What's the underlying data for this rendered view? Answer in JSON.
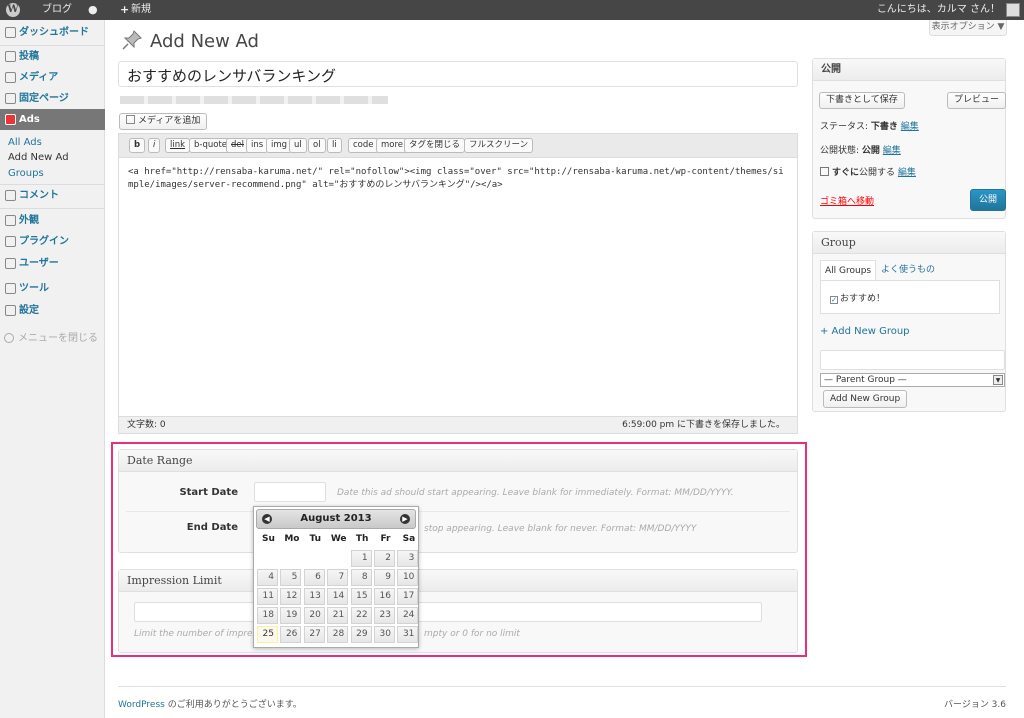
{
  "adminbar": {
    "blog": "ブログ",
    "new": "新規",
    "greeting": "こんにちは、カルマ さん！"
  },
  "sidebar": {
    "items": [
      {
        "label": "ダッシュボード"
      },
      {
        "label": "投稿"
      },
      {
        "label": "メディア"
      },
      {
        "label": "固定ページ"
      },
      {
        "label": "Ads"
      },
      {
        "label": "コメント"
      },
      {
        "label": "外観"
      },
      {
        "label": "プラグイン"
      },
      {
        "label": "ユーザー"
      },
      {
        "label": "ツール"
      },
      {
        "label": "設定"
      }
    ],
    "submenu": [
      "All Ads",
      "Add New Ad",
      "Groups"
    ],
    "collapse": "メニューを閉じる"
  },
  "header": {
    "screen_options": "表示オプション ▼",
    "title": "Add New Ad"
  },
  "post": {
    "title_value": "おすすめのレンサバランキング",
    "add_media": "メディアを追加"
  },
  "editor": {
    "quicktags": [
      "b",
      "i",
      "link",
      "b-quote",
      "del",
      "ins",
      "img",
      "ul",
      "ol",
      "li",
      "code",
      "more",
      "タグを閉じる",
      "フルスクリーン"
    ],
    "content": "<a href=\"http://rensaba-karuma.net/\" rel=\"nofollow\"><img class=\"over\" src=\"http://rensaba-karuma.net/wp-content/themes/simple/images/server-recommend.png\" alt=\"おすすめのレンサバランキング\"/></a>",
    "word_count": "文字数: 0",
    "draft_saved": "6:59:00 pm に下書きを保存しました。"
  },
  "date_range": {
    "heading": "Date Range",
    "start_label": "Start Date",
    "start_desc": "Date this ad should start appearing. Leave blank for immediately. Format: MM/DD/YYYY.",
    "end_label": "End Date",
    "end_desc": "stop appearing. Leave blank for never. Format: MM/DD/YYYY"
  },
  "calendar": {
    "month": "August 2013",
    "dow": [
      "Su",
      "Mo",
      "Tu",
      "We",
      "Th",
      "Fr",
      "Sa"
    ],
    "first_weekday": 4,
    "days": 31,
    "today": 25
  },
  "impression": {
    "heading": "Impression Limit",
    "desc_left": "Limit the number of impress",
    "desc_right": "mpty or 0 for no limit"
  },
  "publish": {
    "heading": "公開",
    "save_draft": "下書きとして保存",
    "preview": "プレビュー",
    "status_label": "ステータス: ",
    "status_value": "下書き",
    "visibility_label": "公開状態: ",
    "visibility_value": "公開",
    "schedule_label": "すぐに",
    "schedule_suffix": "公開する",
    "edit": "編集",
    "trash": "ゴミ箱へ移動",
    "publish": "公開"
  },
  "group": {
    "heading": "Group",
    "tab_all": "All Groups",
    "tab_popular": "よく使うもの",
    "group_item": "おすすめ！",
    "add_new_link": "+ Add New Group",
    "parent_select": "— Parent Group —",
    "add_button": "Add New Group"
  },
  "footer": {
    "wordpress": "WordPress",
    "thanks": " のご利用ありがとうございます。",
    "version": "バージョン 3.6"
  }
}
